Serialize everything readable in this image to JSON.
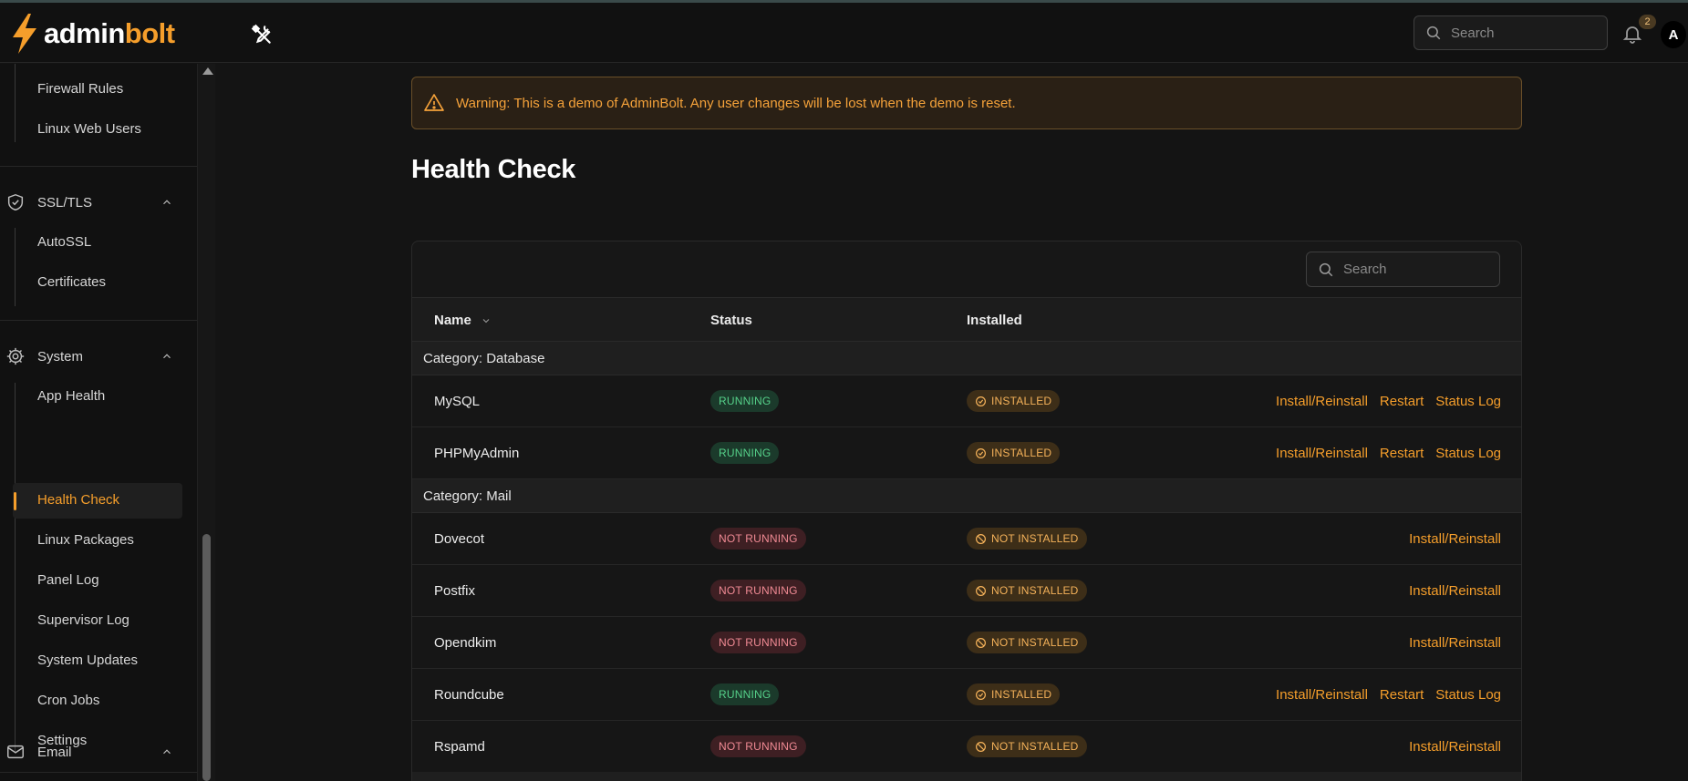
{
  "app": {
    "logo_admin": "admin",
    "logo_bolt": "bolt"
  },
  "topbar": {
    "search_placeholder": "Search",
    "notification_count": "2",
    "avatar_initial": "A"
  },
  "sidebar": {
    "firewall_items": [
      "Firewall Rules",
      "Linux Web Users"
    ],
    "ssl_group": {
      "label": "SSL/TLS",
      "items": [
        "AutoSSL",
        "Certificates"
      ]
    },
    "system_group": {
      "label": "System",
      "items": [
        "App Health",
        "Health Check",
        "Linux Packages",
        "Panel Log",
        "Supervisor Log",
        "System Updates",
        "Cron Jobs",
        "Settings"
      ],
      "active": "Health Check"
    },
    "email_group": {
      "label": "Email"
    }
  },
  "warning": {
    "text": "Warning: This is a demo of AdminBolt. Any user changes will be lost when the demo is reset."
  },
  "page": {
    "title": "Health Check"
  },
  "table": {
    "search_placeholder": "Search",
    "headers": {
      "name": "Name",
      "status": "Status",
      "installed": "Installed"
    },
    "categories": [
      {
        "label": "Category: Database",
        "rows": [
          {
            "name": "MySQL",
            "status": "RUNNING",
            "installed": "INSTALLED",
            "actions": [
              "Install/Reinstall",
              "Restart",
              "Status Log"
            ]
          },
          {
            "name": "PHPMyAdmin",
            "status": "RUNNING",
            "installed": "INSTALLED",
            "actions": [
              "Install/Reinstall",
              "Restart",
              "Status Log"
            ]
          }
        ]
      },
      {
        "label": "Category: Mail",
        "rows": [
          {
            "name": "Dovecot",
            "status": "NOT RUNNING",
            "installed": "NOT INSTALLED",
            "actions": [
              "Install/Reinstall"
            ]
          },
          {
            "name": "Postfix",
            "status": "NOT RUNNING",
            "installed": "NOT INSTALLED",
            "actions": [
              "Install/Reinstall"
            ]
          },
          {
            "name": "Opendkim",
            "status": "NOT RUNNING",
            "installed": "NOT INSTALLED",
            "actions": [
              "Install/Reinstall"
            ]
          },
          {
            "name": "Roundcube",
            "status": "RUNNING",
            "installed": "INSTALLED",
            "actions": [
              "Install/Reinstall",
              "Restart",
              "Status Log"
            ]
          },
          {
            "name": "Rspamd",
            "status": "NOT RUNNING",
            "installed": "NOT INSTALLED",
            "actions": [
              "Install/Reinstall"
            ]
          }
        ]
      }
    ]
  },
  "colors": {
    "accent": "#f59e2b",
    "running": "#56d18a",
    "not_running": "#f08a94",
    "background": "#141414"
  }
}
